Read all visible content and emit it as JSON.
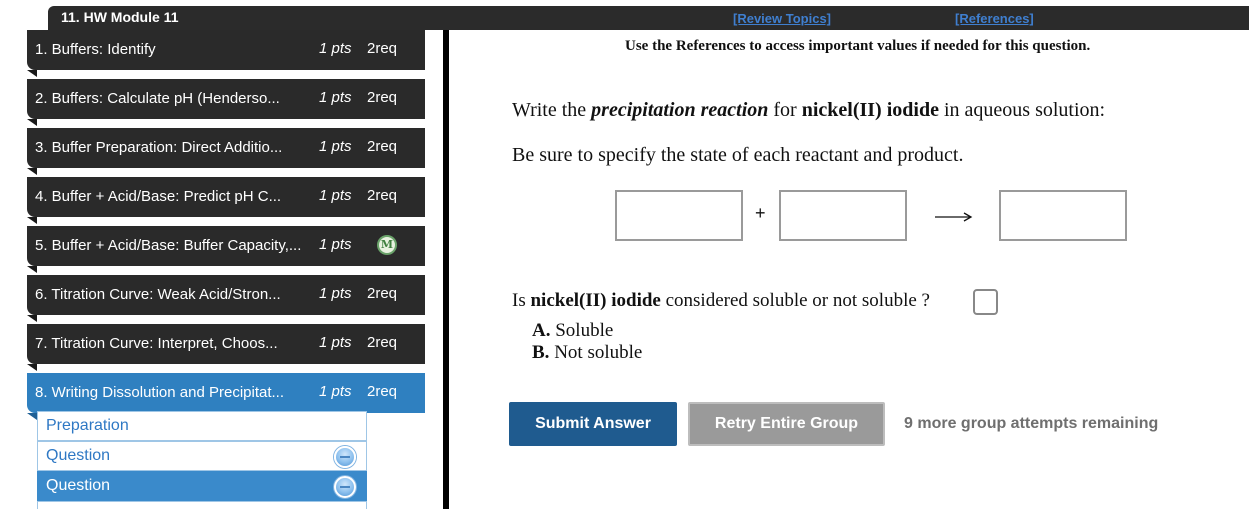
{
  "module": {
    "title": "11. HW Module 11",
    "review_topics": "[Review Topics]",
    "references": "[References]"
  },
  "sidebar": {
    "items": [
      {
        "label": "1. Buffers: Identify",
        "pts": "1 pts",
        "req": "2req"
      },
      {
        "label": "2. Buffers: Calculate pH (Henderso...",
        "pts": "1 pts",
        "req": "2req"
      },
      {
        "label": "3. Buffer Preparation: Direct Additio...",
        "pts": "1 pts",
        "req": "2req"
      },
      {
        "label": "4. Buffer + Acid/Base: Predict pH C...",
        "pts": "1 pts",
        "req": "2req"
      },
      {
        "label": "5. Buffer + Acid/Base: Buffer Capacity,...",
        "pts": "1 pts",
        "badge": "M"
      },
      {
        "label": "6. Titration Curve: Weak Acid/Stron...",
        "pts": "1 pts",
        "req": "2req"
      },
      {
        "label": "7. Titration Curve: Interpret, Choos...",
        "pts": "1 pts",
        "req": "2req"
      },
      {
        "label": "8. Writing Dissolution and Precipitat...",
        "pts": "1 pts",
        "req": "2req"
      }
    ],
    "subitems": [
      {
        "label": "Preparation"
      },
      {
        "label": "Question"
      },
      {
        "label": "Question"
      }
    ]
  },
  "main": {
    "ref_note": "Use the References to access important values if needed for this question.",
    "prompt": {
      "pre": "Write the ",
      "emph": "precipitation reaction",
      "mid": " for ",
      "compound": "nickel(II) iodide",
      "post": " in aqueous solution:"
    },
    "prompt2": "Be sure to specify the state of each reactant and product.",
    "plus": "+",
    "solubility": {
      "pre": "Is ",
      "compound": "nickel(II) iodide",
      "post": " considered soluble or not soluble ?",
      "options": [
        {
          "key": "A.",
          "text": "Soluble"
        },
        {
          "key": "B.",
          "text": "Not soluble"
        }
      ]
    },
    "buttons": {
      "submit": "Submit Answer",
      "retry": "Retry Entire Group"
    },
    "attempts": "9 more group attempts remaining"
  }
}
